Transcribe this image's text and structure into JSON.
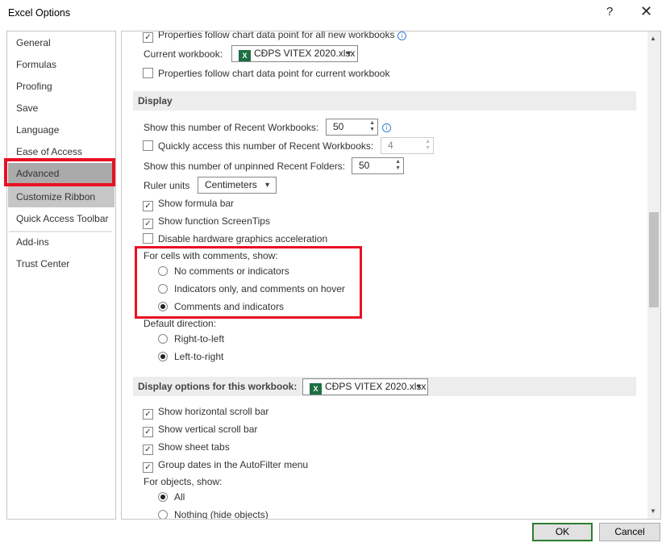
{
  "window": {
    "title": "Excel Options",
    "help": "?",
    "close": "✕"
  },
  "nav": [
    "General",
    "Formulas",
    "Proofing",
    "Save",
    "Language",
    "Ease of Access",
    "Advanced",
    "Customize Ribbon",
    "Quick Access Toolbar",
    "Add-ins",
    "Trust Center"
  ],
  "chart": {
    "prop_all": "Properties follow chart data point for all new workbooks",
    "current_wb_label": "Current workbook:",
    "current_wb": "CĐPS VITEX 2020.xlsx",
    "prop_current": "Properties follow chart data point for current workbook"
  },
  "display": {
    "header": "Display",
    "recent_wb_label": "Show this number of Recent Workbooks:",
    "recent_wb": "50",
    "quick_label": "Quickly access this number of Recent Workbooks:",
    "quick": "4",
    "folders_label": "Show this number of unpinned Recent Folders:",
    "folders": "50",
    "ruler_label": "Ruler units",
    "ruler": "Centimeters",
    "formula_bar": "Show formula bar",
    "screentips": "Show function ScreenTips",
    "hw_accel": "Disable hardware graphics acceleration",
    "comments_label": "For cells with comments, show:",
    "c1": "No comments or indicators",
    "c2": "Indicators only, and comments on hover",
    "c3": "Comments and indicators",
    "dir_label": "Default direction:",
    "rtl": "Right-to-left",
    "ltr": "Left-to-right"
  },
  "wb": {
    "header": "Display options for this workbook:",
    "file": "CĐPS VITEX 2020.xlsx",
    "hscroll": "Show horizontal scroll bar",
    "vscroll": "Show vertical scroll bar",
    "tabs": "Show sheet tabs",
    "group": "Group dates in the AutoFilter menu",
    "objects_label": "For objects, show:",
    "all": "All",
    "nothing": "Nothing (hide objects)"
  },
  "buttons": {
    "ok": "OK",
    "cancel": "Cancel"
  }
}
